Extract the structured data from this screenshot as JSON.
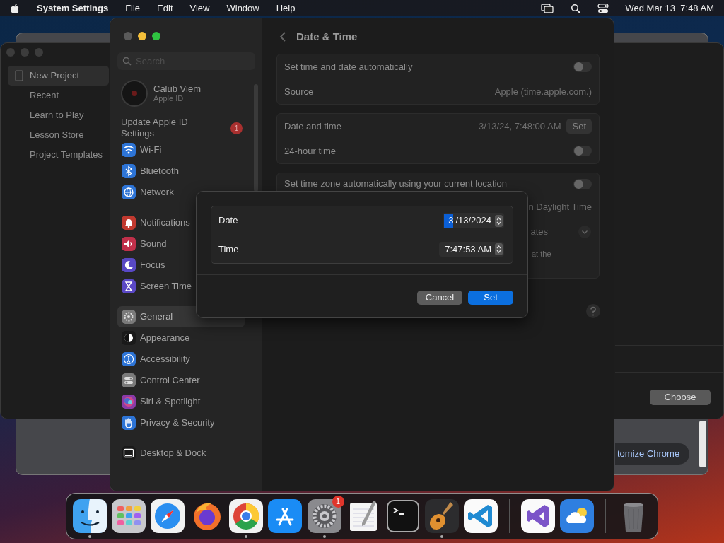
{
  "menu_bar": {
    "app_name": "System Settings",
    "menus": [
      "File",
      "Edit",
      "View",
      "Window",
      "Help"
    ],
    "clock": "Wed Mar 13  7:48 AM"
  },
  "chrome_window": {
    "button": "tomize Chrome"
  },
  "garageband_window": {
    "sidebar": [
      {
        "label": "New Project",
        "selected": true
      },
      {
        "label": "Recent",
        "selected": false
      },
      {
        "label": "Learn to Play",
        "selected": false
      },
      {
        "label": "Lesson Store",
        "selected": false
      },
      {
        "label": "Project Templates",
        "selected": false
      }
    ],
    "button": "Choose"
  },
  "settings_window": {
    "search": {
      "placeholder": "Search"
    },
    "account": {
      "name": "Calub Viem",
      "subtitle": "Apple ID"
    },
    "notice": {
      "label": "Update Apple ID Settings",
      "badge": "1"
    },
    "sidebar_groups": [
      [
        {
          "label": "Wi-Fi",
          "color": "#2d74d6",
          "selected": false
        },
        {
          "label": "Bluetooth",
          "color": "#2d74d6",
          "selected": false
        },
        {
          "label": "Network",
          "color": "#2d74d6",
          "selected": false
        }
      ],
      [
        {
          "label": "Notifications",
          "color": "#c0392f",
          "selected": false
        },
        {
          "label": "Sound",
          "color": "#c0304a",
          "selected": false
        },
        {
          "label": "Focus",
          "color": "#5848c4",
          "selected": false
        },
        {
          "label": "Screen Time",
          "color": "#5a48c6",
          "selected": false
        }
      ],
      [
        {
          "label": "General",
          "color": "#7a7a7a",
          "selected": true
        },
        {
          "label": "Appearance",
          "color": "#1a1a1a",
          "selected": false
        },
        {
          "label": "Accessibility",
          "color": "#2d74d6",
          "selected": false
        },
        {
          "label": "Control Center",
          "color": "#7a7a7a",
          "selected": false
        },
        {
          "label": "Siri & Spotlight",
          "color": "#8a3aa8",
          "selected": false
        },
        {
          "label": "Privacy & Security",
          "color": "#2d74d6",
          "selected": false
        }
      ],
      [
        {
          "label": "Desktop & Dock",
          "color": "#1a1a1a",
          "selected": false
        }
      ]
    ],
    "title": "Date & Time",
    "groups": [
      {
        "rows": [
          {
            "kind": "toggle",
            "label": "Set time and date automatically",
            "on": false
          },
          {
            "kind": "value",
            "label": "Source",
            "value": "Apple (time.apple.com.)"
          }
        ]
      },
      {
        "rows": [
          {
            "kind": "button",
            "label": "Date and time",
            "value": "3/13/24, 7:48:00 AM",
            "button": "Set"
          },
          {
            "kind": "toggle",
            "label": "24-hour time",
            "on": false
          }
        ]
      },
      {
        "rows": [
          {
            "kind": "toggle",
            "label": "Set time zone automatically using your current location",
            "on": false
          },
          {
            "kind": "value",
            "value": "n Daylight Time"
          },
          {
            "kind": "popup",
            "value": "ates"
          },
          {
            "kind": "note",
            "value": "at the"
          }
        ]
      }
    ]
  },
  "dialog": {
    "rows": [
      {
        "label": "Date",
        "segments": [
          {
            "text": "3",
            "selected": true
          },
          {
            "text": "/13/2024",
            "selected": false
          }
        ]
      },
      {
        "label": "Time",
        "segments": [
          {
            "text": "7:47:53 AM",
            "selected": false
          }
        ]
      }
    ],
    "buttons": [
      {
        "label": "Cancel",
        "primary": false
      },
      {
        "label": "Set",
        "primary": true
      }
    ]
  },
  "dock": {
    "groups": [
      [
        {
          "running": true
        },
        {
          "running": false
        },
        {
          "running": false
        },
        {
          "running": false
        },
        {
          "running": true
        },
        {
          "running": false
        },
        {
          "running": true,
          "badge": "1"
        },
        {
          "running": false
        },
        {
          "running": false
        },
        {
          "running": true
        },
        {
          "running": false
        }
      ],
      [
        {
          "running": false
        },
        {
          "running": false
        }
      ],
      [
        {
          "running": false
        }
      ]
    ]
  }
}
